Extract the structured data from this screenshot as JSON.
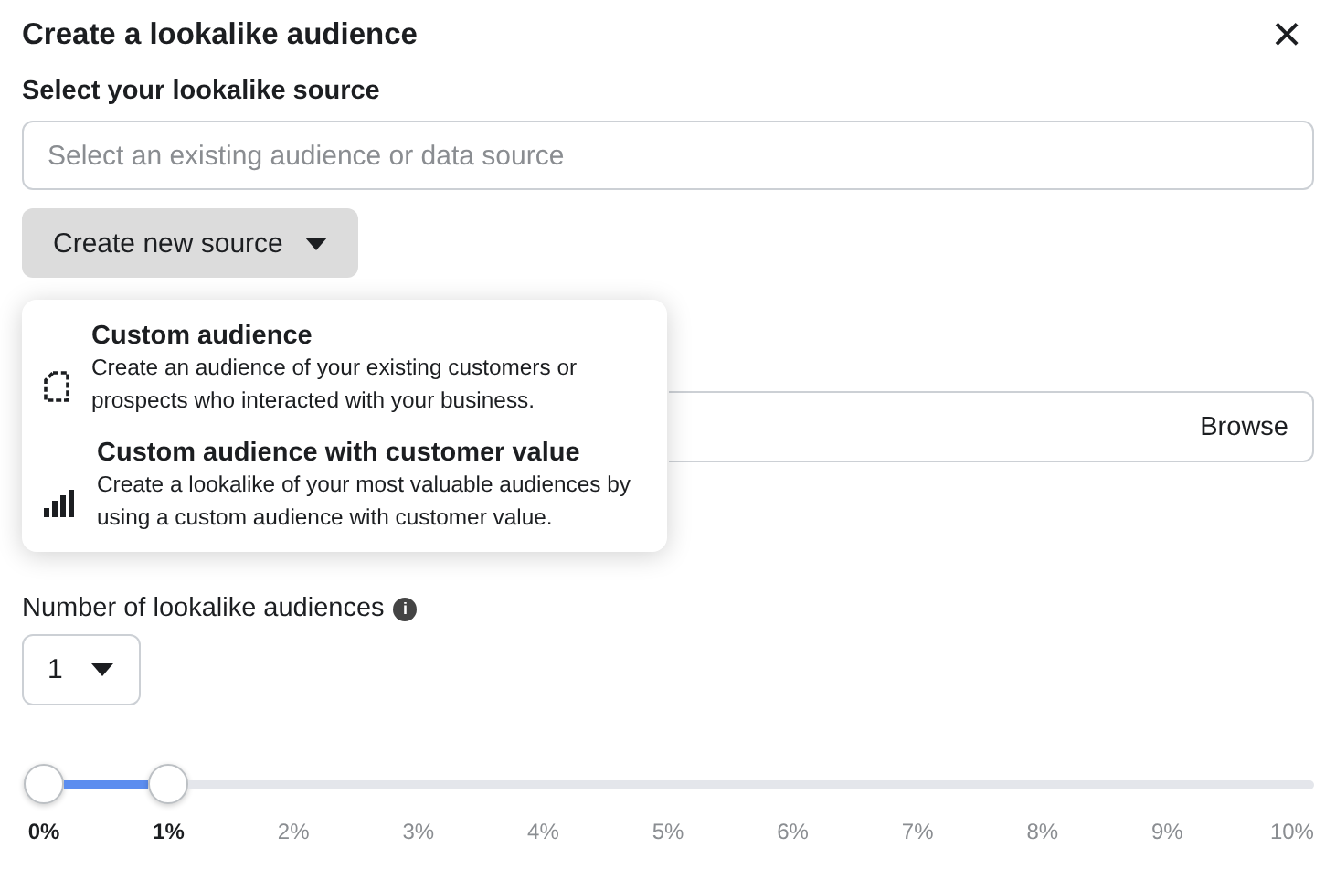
{
  "dialog": {
    "title": "Create a lookalike audience",
    "close": "×"
  },
  "source": {
    "label": "Select your lookalike source",
    "placeholder": "Select an existing audience or data source"
  },
  "create_button": {
    "label": "Create new source",
    "expanded": true
  },
  "menu": [
    {
      "kind": "document",
      "title": "Custom audience",
      "description": "Create an audience of your existing customers or prospects who interacted with your business."
    },
    {
      "kind": "bars",
      "title": "Custom audience with customer value",
      "description": "Create a lookalike of your most valuable audiences by using a custom audience with customer value."
    }
  ],
  "location_field": {
    "button": "Browse"
  },
  "count": {
    "label": "Number of lookalike audiences",
    "info": "i",
    "value": "1"
  },
  "slider": {
    "thumbs": [
      {
        "level": 0
      },
      {
        "level": 0.1
      }
    ],
    "ticks": [
      {
        "label": "0%",
        "selected": true
      },
      {
        "label": "1%",
        "selected": true
      },
      {
        "label": "2%",
        "selected": false
      },
      {
        "label": "3%",
        "selected": false
      },
      {
        "label": "4%",
        "selected": false
      },
      {
        "label": "5%",
        "selected": false
      },
      {
        "label": "6%",
        "selected": false
      },
      {
        "label": "7%",
        "selected": false
      },
      {
        "label": "8%",
        "selected": false
      },
      {
        "label": "9%",
        "selected": false
      },
      {
        "label": "10%",
        "selected": false
      }
    ]
  }
}
